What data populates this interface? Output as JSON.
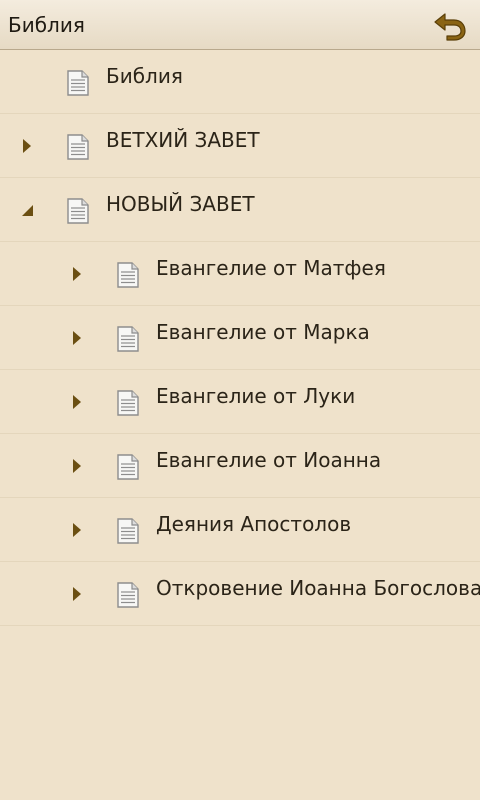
{
  "header": {
    "title": "Библия",
    "back_icon": "undo-arrow-icon"
  },
  "colors": {
    "background": "#efe2cb",
    "accent": "#7a5a12",
    "divider": "#e4d6bc"
  },
  "tree": {
    "items": [
      {
        "label": "Библия",
        "level": 0,
        "arrow": "none",
        "icon": "document-icon"
      },
      {
        "label": "ВЕТХИЙ ЗАВЕТ",
        "level": 0,
        "arrow": "collapsed",
        "icon": "document-icon"
      },
      {
        "label": "НОВЫЙ ЗАВЕТ",
        "level": 0,
        "arrow": "expanded",
        "icon": "document-icon"
      },
      {
        "label": "Евангелие от Матфея",
        "level": 1,
        "arrow": "collapsed",
        "icon": "document-icon"
      },
      {
        "label": "Евангелие от Марка",
        "level": 1,
        "arrow": "collapsed",
        "icon": "document-icon"
      },
      {
        "label": "Евангелие от Луки",
        "level": 1,
        "arrow": "collapsed",
        "icon": "document-icon"
      },
      {
        "label": "Евангелие от Иоанна",
        "level": 1,
        "arrow": "collapsed",
        "icon": "document-icon"
      },
      {
        "label": "Деяния Апостолов",
        "level": 1,
        "arrow": "collapsed",
        "icon": "document-icon"
      },
      {
        "label": "Откровение Иоанна Богослова",
        "level": 1,
        "arrow": "collapsed",
        "icon": "document-icon"
      }
    ]
  }
}
